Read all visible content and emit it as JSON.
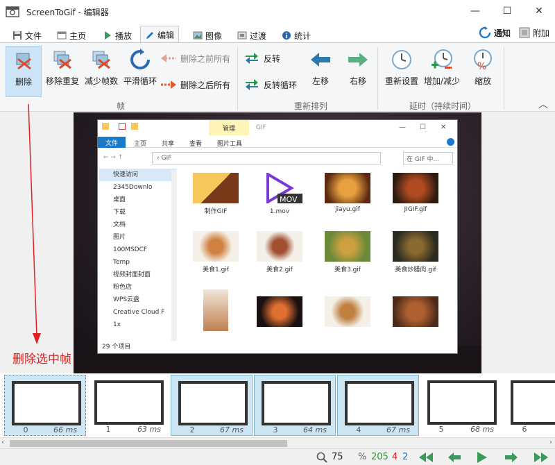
{
  "window": {
    "title": "ScreenToGif - 编辑器",
    "minimize": "—",
    "maximize": "☐",
    "close": "✕"
  },
  "tabs": [
    {
      "label": "文件",
      "icon": "save-icon"
    },
    {
      "label": "主页",
      "icon": "home-icon"
    },
    {
      "label": "播放",
      "icon": "play-icon"
    },
    {
      "label": "编辑",
      "icon": "edit-icon",
      "active": true
    },
    {
      "label": "图像",
      "icon": "image-icon"
    },
    {
      "label": "过渡",
      "icon": "transition-icon"
    },
    {
      "label": "统计",
      "icon": "info-icon"
    }
  ],
  "tab_right": {
    "notify": "通知",
    "attach": "附加"
  },
  "ribbon": {
    "frame_group": {
      "label": "帧",
      "delete": "删除",
      "remove_duplicates": "移除重复",
      "reduce_frames": "减少帧数",
      "smooth_loop": "平滑循环",
      "delete_previous": "删除之前所有",
      "delete_next": "删除之后所有"
    },
    "reorder_group": {
      "label": "重新排列",
      "reverse": "反转",
      "yoyo": "反转循环",
      "move_left": "左移",
      "move_right": "右移"
    },
    "delay_group": {
      "label": "延时（持续时间）",
      "override": "重新设置",
      "increase_decrease": "增加/减少",
      "scale": "缩放"
    }
  },
  "explorer": {
    "manage": "管理",
    "title": "GIF",
    "file_tab": "文件",
    "ribbon_tabs": [
      "主页",
      "共享",
      "查看",
      "图片工具"
    ],
    "address": "GIF",
    "search_placeholder": "在 GIF 中...",
    "nav_items": [
      "快速访问",
      "2345Downlo",
      "桌面",
      "下载",
      "文档",
      "图片",
      "100MSDCF",
      "Temp",
      "视频封面封面",
      "粉色店",
      "WPS云盘",
      "Creative Cloud F",
      "1x"
    ],
    "files": [
      "制作GIF",
      "1.mov",
      "jiayu.gif",
      "JIGIF.gif",
      "美食1.gif",
      "美食2.gif",
      "美食3.gif",
      "美食炒腊肉.gif",
      "",
      "",
      "",
      ""
    ],
    "mov_badge": "MOV",
    "item_count": "29 个项目"
  },
  "annotation": "删除选中帧",
  "timeline": [
    {
      "index": "0",
      "delay": "66 ms",
      "selected": true,
      "current": true
    },
    {
      "index": "1",
      "delay": "63 ms",
      "selected": false
    },
    {
      "index": "2",
      "delay": "67 ms",
      "selected": true
    },
    {
      "index": "3",
      "delay": "64 ms",
      "selected": true
    },
    {
      "index": "4",
      "delay": "67 ms",
      "selected": true
    },
    {
      "index": "5",
      "delay": "68 ms",
      "selected": false
    },
    {
      "index": "6",
      "delay": "",
      "selected": false
    }
  ],
  "statusbar": {
    "zoom": "75",
    "zoom_unit": "%",
    "frame_count": "205",
    "selected_count": "4",
    "current_frame": "2"
  },
  "colors": {
    "accent": "#1979ca",
    "red": "#e02020",
    "green": "#22a032"
  }
}
